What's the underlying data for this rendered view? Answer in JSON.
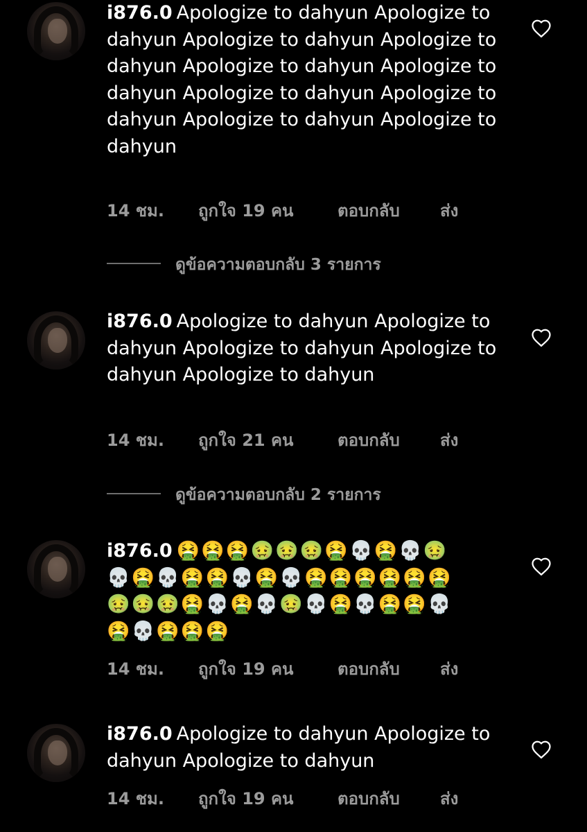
{
  "colors": {
    "background": "#000000",
    "text": "#ffffff",
    "meta": "#9b9b9b",
    "divider": "#6e6e6e"
  },
  "comments": [
    {
      "username": "i876.0",
      "text": "Apologize to dahyun Apologize to dahyun Apologize to dahyun Apologize to dahyun Apologize to dahyun Apologize to dahyun Apologize to dahyun Apologize to dahyun Apologize to dahyun Apologize to dahyun",
      "time": "14 ชม.",
      "likes": "ถูกใจ 19 คน",
      "reply": "ตอบกลับ",
      "send": "ส่ง",
      "view_replies": "ดูข้อความตอบกลับ 3 รายการ",
      "icon": "heart-outline-icon"
    },
    {
      "username": "i876.0",
      "text": "Apologize to dahyun Apologize to dahyun Apologize to dahyun Apologize to dahyun Apologize to dahyun",
      "time": "14 ชม.",
      "likes": "ถูกใจ 21 คน",
      "reply": "ตอบกลับ",
      "send": "ส่ง",
      "view_replies": "ดูข้อความตอบกลับ 2 รายการ",
      "icon": "heart-outline-icon"
    },
    {
      "username": "i876.0",
      "emoji_lines": [
        "🤮🤮🤮🤢🤢🤢🤮💀🤮💀🤢",
        "💀🤮💀🤮🤮💀🤮💀🤮🤮🤮🤮🤮🤮",
        "🤢🤢🤢🤮💀🤮💀🤢💀🤮💀🤮🤮💀",
        "🤮💀🤮🤮🤮"
      ],
      "time": "14 ชม.",
      "likes": "ถูกใจ 19 คน",
      "reply": "ตอบกลับ",
      "send": "ส่ง",
      "icon": "heart-outline-icon"
    },
    {
      "username": "i876.0",
      "text": "Apologize to dahyun Apologize to dahyun Apologize to dahyun",
      "time": "14 ชม.",
      "likes": "ถูกใจ 19 คน",
      "reply": "ตอบกลับ",
      "send": "ส่ง",
      "icon": "heart-outline-icon"
    }
  ]
}
